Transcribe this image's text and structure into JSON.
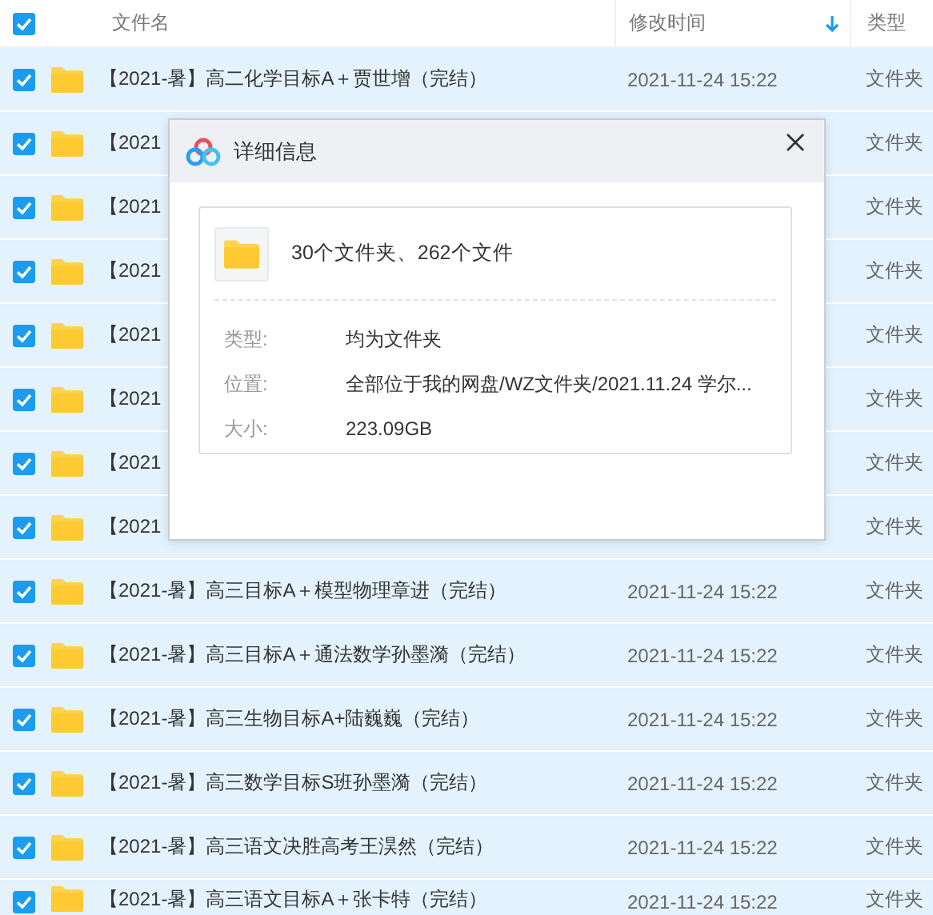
{
  "header": {
    "checked": true,
    "columns": [
      {
        "label": "文件名"
      },
      {
        "label": "修改时间",
        "sorted": true
      },
      {
        "label": "类型"
      }
    ]
  },
  "rows": [
    {
      "checked": true,
      "name": "【2021-暑】高二化学目标A＋贾世增（完结）",
      "date": "2021-11-24 15:22",
      "type": "文件夹"
    },
    {
      "checked": true,
      "name": "【2021",
      "type": "文件夹"
    },
    {
      "checked": true,
      "name": "【2021",
      "type": "文件夹"
    },
    {
      "checked": true,
      "name": "【2021",
      "type": "文件夹"
    },
    {
      "checked": true,
      "name": "【2021",
      "type": "文件夹"
    },
    {
      "checked": true,
      "name": "【2021",
      "type": "文件夹"
    },
    {
      "checked": true,
      "name": "【2021",
      "type": "文件夹"
    },
    {
      "checked": true,
      "name": "【2021",
      "type": "文件夹"
    },
    {
      "checked": true,
      "name": "【2021-暑】高三目标A＋模型物理章进（完结）",
      "date": "2021-11-24 15:22",
      "type": "文件夹"
    },
    {
      "checked": true,
      "name": "【2021-暑】高三目标A＋通法数学孙墨漪（完结）",
      "date": "2021-11-24 15:22",
      "type": "文件夹"
    },
    {
      "checked": true,
      "name": "【2021-暑】高三生物目标A+陆巍巍（完结）",
      "date": "2021-11-24 15:22",
      "type": "文件夹"
    },
    {
      "checked": true,
      "name": "【2021-暑】高三数学目标S班孙墨漪（完结）",
      "date": "2021-11-24 15:22",
      "type": "文件夹"
    },
    {
      "checked": true,
      "name": "【2021-暑】高三语文决胜高考王淏然（完结）",
      "date": "2021-11-24 15:22",
      "type": "文件夹"
    },
    {
      "checked": true,
      "name": "【2021-暑】高三语文目标A＋张卡特（完结）",
      "date": "2021-11-24 15:22",
      "type": "文件夹"
    }
  ],
  "dialog": {
    "title": "详细信息",
    "summary": "30个文件夹、262个文件",
    "details": [
      {
        "label": "类型:",
        "value": "均为文件夹"
      },
      {
        "label": "位置:",
        "value": "全部位于我的网盘/WZ文件夹/2021.11.24 学尔..."
      },
      {
        "label": "大小:",
        "value": "223.09GB"
      }
    ]
  }
}
